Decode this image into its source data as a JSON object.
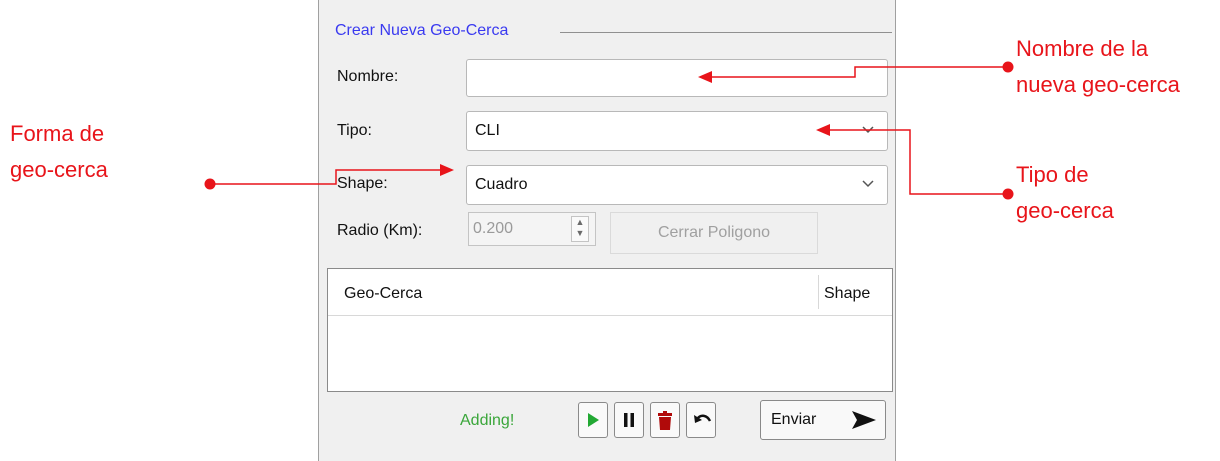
{
  "form": {
    "group_title": "Crear Nueva Geo-Cerca",
    "name_label": "Nombre:",
    "name_value": "",
    "type_label": "Tipo:",
    "type_value": "CLI",
    "shape_label": "Shape:",
    "shape_value": "Cuadro",
    "radius_label": "Radio (Km):",
    "radius_value": "0.200",
    "close_polygon_label": "Cerrar Poligono"
  },
  "list": {
    "columns": [
      "Geo-Cerca",
      "Shape"
    ],
    "rows": []
  },
  "toolbar": {
    "status": "Adding!",
    "play_icon": "play-icon",
    "pause_icon": "pause-icon",
    "delete_icon": "trash-icon",
    "undo_icon": "undo-icon",
    "send_label": "Enviar",
    "send_icon": "send-arrow-icon"
  },
  "annotations": {
    "nombre_line1": "Nombre de la",
    "nombre_line2": "nueva geo-cerca",
    "forma_line1": "Forma de",
    "forma_line2": "geo-cerca",
    "tipo_line1": "Tipo de",
    "tipo_line2": "geo-cerca",
    "color": "#e8141a"
  }
}
